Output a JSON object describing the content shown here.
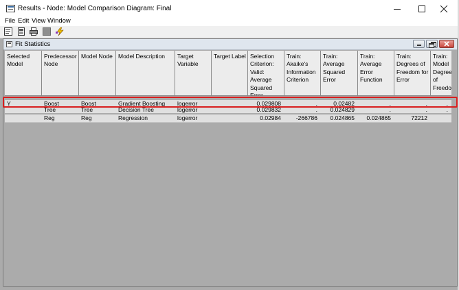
{
  "window": {
    "title": "Results - Node: Model Comparison  Diagram: Final"
  },
  "menu": [
    "File",
    "Edit",
    "View",
    "Window"
  ],
  "toolbar": {
    "icons": [
      "properties-icon",
      "view-icon",
      "print-icon",
      "stop-icon",
      "lightning-icon"
    ]
  },
  "child_window": {
    "title": "Fit Statistics"
  },
  "table": {
    "headers": [
      "Selected Model",
      "Predecessor Node",
      "Model Node",
      "Model Description",
      "Target Variable",
      "Target Label",
      "Selection Criterion: Valid: Average Squared Error",
      "Train: Akaike's Information Criterion",
      "Train: Average Squared Error",
      "Train: Average Error Function",
      "Train: Degrees of Freedom for Error",
      "Train: Model Degrees of Freedom"
    ],
    "rows": [
      [
        "Y",
        "Boost",
        "Boost",
        "Gradient Boosting",
        "logerror",
        "",
        "0.029808",
        ".",
        "0.02482",
        ".",
        ".",
        "."
      ],
      [
        "",
        "Tree",
        "Tree",
        "Decision Tree",
        "logerror",
        "",
        "0.029832",
        ".",
        "0.024829",
        ".",
        ".",
        "."
      ],
      [
        "",
        "Reg",
        "Reg",
        "Regression",
        "logerror",
        "",
        "0.02984",
        "-266786",
        "0.024865",
        "0.024865",
        "72212",
        ""
      ]
    ]
  },
  "colors": {
    "highlight": "#d81e1e",
    "mdi_background": "#ababab",
    "header_background": "#ececec"
  }
}
